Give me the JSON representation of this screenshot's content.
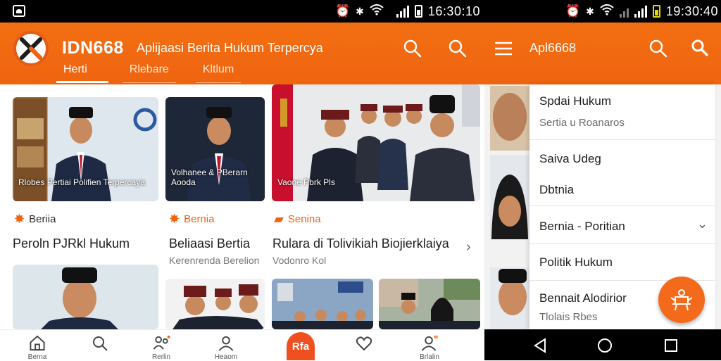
{
  "status_bar": {
    "left_time": "16:30:10",
    "right_time": "19:30:40",
    "icons": [
      "alarm-icon",
      "bluetooth-icon",
      "wifi-icon",
      "signal-icon",
      "battery-icon"
    ]
  },
  "app_bar": {
    "brand": "IDN668",
    "tagline": "Aplijaasi Berita Hukum Terpercya",
    "tabs": [
      {
        "label": "Herti"
      },
      {
        "label": "Rlebare"
      },
      {
        "label": "Kltlum"
      }
    ]
  },
  "cards": [
    {
      "caption": "Rlobes Pertiai Polifien Terpercaya",
      "category": "Beriia",
      "headline": "Peroln PJRkl Hukum",
      "subtitle": ""
    },
    {
      "caption": "Volhanee & PBerarn Aooda",
      "category": "Bernia",
      "headline": "Beliaasi  Bertia",
      "subtitle": "Kerenrenda Berelion"
    },
    {
      "caption": "Vaone Pbrk Pls",
      "category": "Senina",
      "headline": "Rulara di Tolivikiah Biojierklaiya",
      "subtitle": "Vodonro Kol"
    }
  ],
  "bottom_nav": {
    "items": [
      {
        "label": "Berna"
      },
      {
        "label": ""
      },
      {
        "label": "Rerlin"
      },
      {
        "label": "Heaom"
      },
      {
        "label": "Rfa"
      },
      {
        "label": ""
      },
      {
        "label": "Brlalin"
      }
    ]
  },
  "right_panel": {
    "title": "Apl6668",
    "drawer": [
      {
        "label": "Spdai Hukum",
        "sub": "Sertia u Roanaros"
      },
      {
        "label": "Saiva Udeg",
        "sub": ""
      },
      {
        "label": "Dbtnia",
        "sub": ""
      },
      {
        "label": "Bernia - Poritian",
        "sub": ""
      },
      {
        "label": "Politik Hukum",
        "sub": ""
      },
      {
        "label": "Bennait Alodirior",
        "sub": "Tlolais Rbes"
      }
    ]
  },
  "colors": {
    "primary": "#ef6410",
    "accent": "#f26a1a",
    "dark": "#000000"
  }
}
